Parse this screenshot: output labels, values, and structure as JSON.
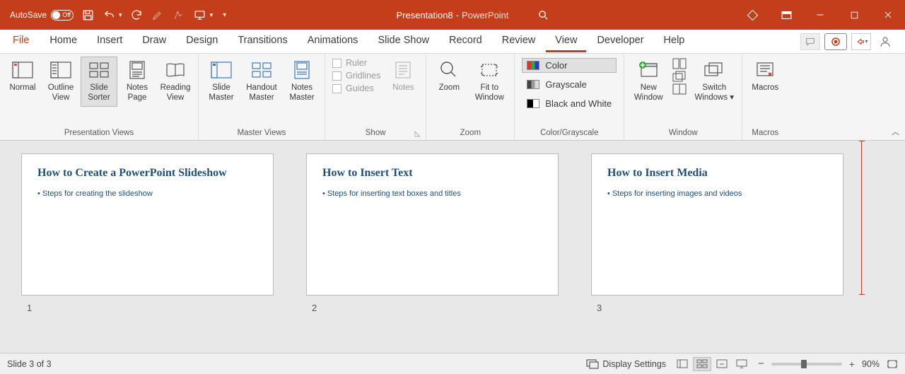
{
  "titlebar": {
    "autosave_label": "AutoSave",
    "toggle_state": "Off",
    "doc_name": "Presentation8",
    "app_name": "PowerPoint"
  },
  "tabs": {
    "file": "File",
    "items": [
      "Home",
      "Insert",
      "Draw",
      "Design",
      "Transitions",
      "Animations",
      "Slide Show",
      "Record",
      "Review",
      "View",
      "Developer",
      "Help"
    ],
    "active": "View"
  },
  "ribbon": {
    "presentation_views": {
      "label": "Presentation Views",
      "normal": "Normal",
      "outline": "Outline View",
      "sorter": "Slide Sorter",
      "notes_page": "Notes Page",
      "reading": "Reading View"
    },
    "master_views": {
      "label": "Master Views",
      "slide": "Slide Master",
      "handout": "Handout Master",
      "notes": "Notes Master"
    },
    "show": {
      "label": "Show",
      "ruler": "Ruler",
      "gridlines": "Gridlines",
      "guides": "Guides",
      "notes": "Notes"
    },
    "zoom": {
      "label": "Zoom",
      "zoom": "Zoom",
      "fit": "Fit to Window"
    },
    "color": {
      "label": "Color/Grayscale",
      "color": "Color",
      "grayscale": "Grayscale",
      "bw": "Black and White"
    },
    "window": {
      "label": "Window",
      "new": "New Window",
      "switch": "Switch Windows"
    },
    "macros": {
      "label": "Macros",
      "macros": "Macros"
    }
  },
  "slides": [
    {
      "title": "How to Create a PowerPoint Slideshow",
      "bullet": "Steps for creating the slideshow",
      "num": "1"
    },
    {
      "title": "How to Insert Text",
      "bullet": "Steps for inserting text boxes and titles",
      "num": "2"
    },
    {
      "title": "How to Insert Media",
      "bullet": "Steps for inserting images and videos",
      "num": "3"
    }
  ],
  "statusbar": {
    "slide_info": "Slide 3 of 3",
    "display_settings": "Display Settings",
    "zoom_minus": "−",
    "zoom_plus": "+",
    "zoom_pct": "90%"
  }
}
